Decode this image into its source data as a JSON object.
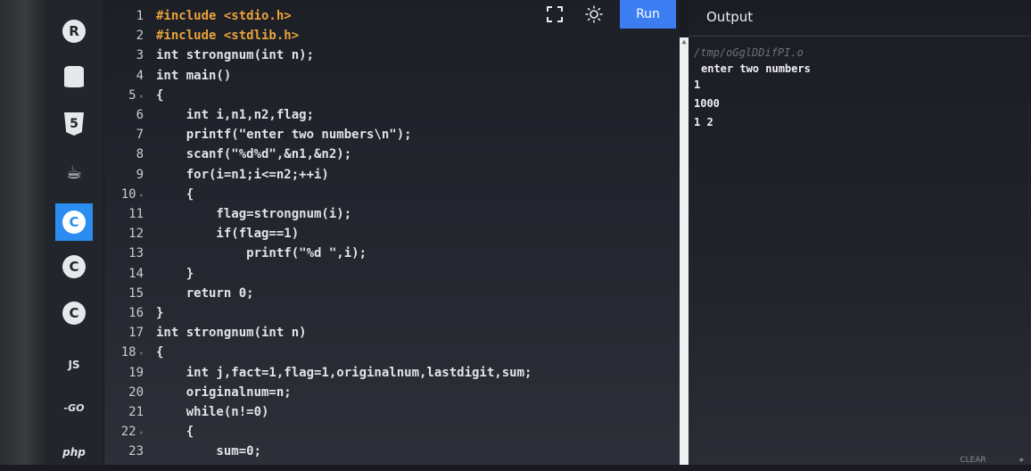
{
  "sidebar": {
    "items": [
      {
        "name": "r",
        "label": "R"
      },
      {
        "name": "sql",
        "label": ""
      },
      {
        "name": "html5",
        "label": "5"
      },
      {
        "name": "java",
        "label": "☕"
      },
      {
        "name": "c",
        "label": "C"
      },
      {
        "name": "cpp",
        "label": "C"
      },
      {
        "name": "csharp",
        "label": "C"
      },
      {
        "name": "js",
        "label": "JS"
      },
      {
        "name": "go",
        "label": "-GO"
      },
      {
        "name": "php",
        "label": "php"
      }
    ]
  },
  "toolbar": {
    "run_label": "Run"
  },
  "editor": {
    "line_numbers": [
      "1",
      "2",
      "3",
      "4",
      "5",
      "6",
      "7",
      "8",
      "9",
      "10",
      "11",
      "12",
      "13",
      "14",
      "15",
      "16",
      "17",
      "18",
      "19",
      "20",
      "21",
      "22",
      "23"
    ],
    "lines": [
      "#include <stdio.h>",
      "#include <stdlib.h>",
      "int strongnum(int n);",
      "int main()",
      "{",
      "    int i,n1,n2,flag;",
      "    printf(\"enter two numbers\\n\");",
      "    scanf(\"%d%d\",&n1,&n2);",
      "    for(i=n1;i<=n2;++i)",
      "    {",
      "        flag=strongnum(i);",
      "        if(flag==1)",
      "            printf(\"%d \",i);",
      "    }",
      "    return 0;",
      "}",
      "int strongnum(int n)",
      "{",
      "    int j,fact=1,flag=1,originalnum,lastdigit,sum;",
      "    originalnum=n;",
      "    while(n!=0)",
      "    {",
      "        sum=0;"
    ]
  },
  "output": {
    "title": "Output",
    "lines": [
      "/tmp/oGglDDifPI.o",
      "enter two numbers",
      "1",
      "1000",
      "1 2"
    ]
  },
  "footer": {
    "clear_label": "CLEAR",
    "expand_label": "»"
  }
}
